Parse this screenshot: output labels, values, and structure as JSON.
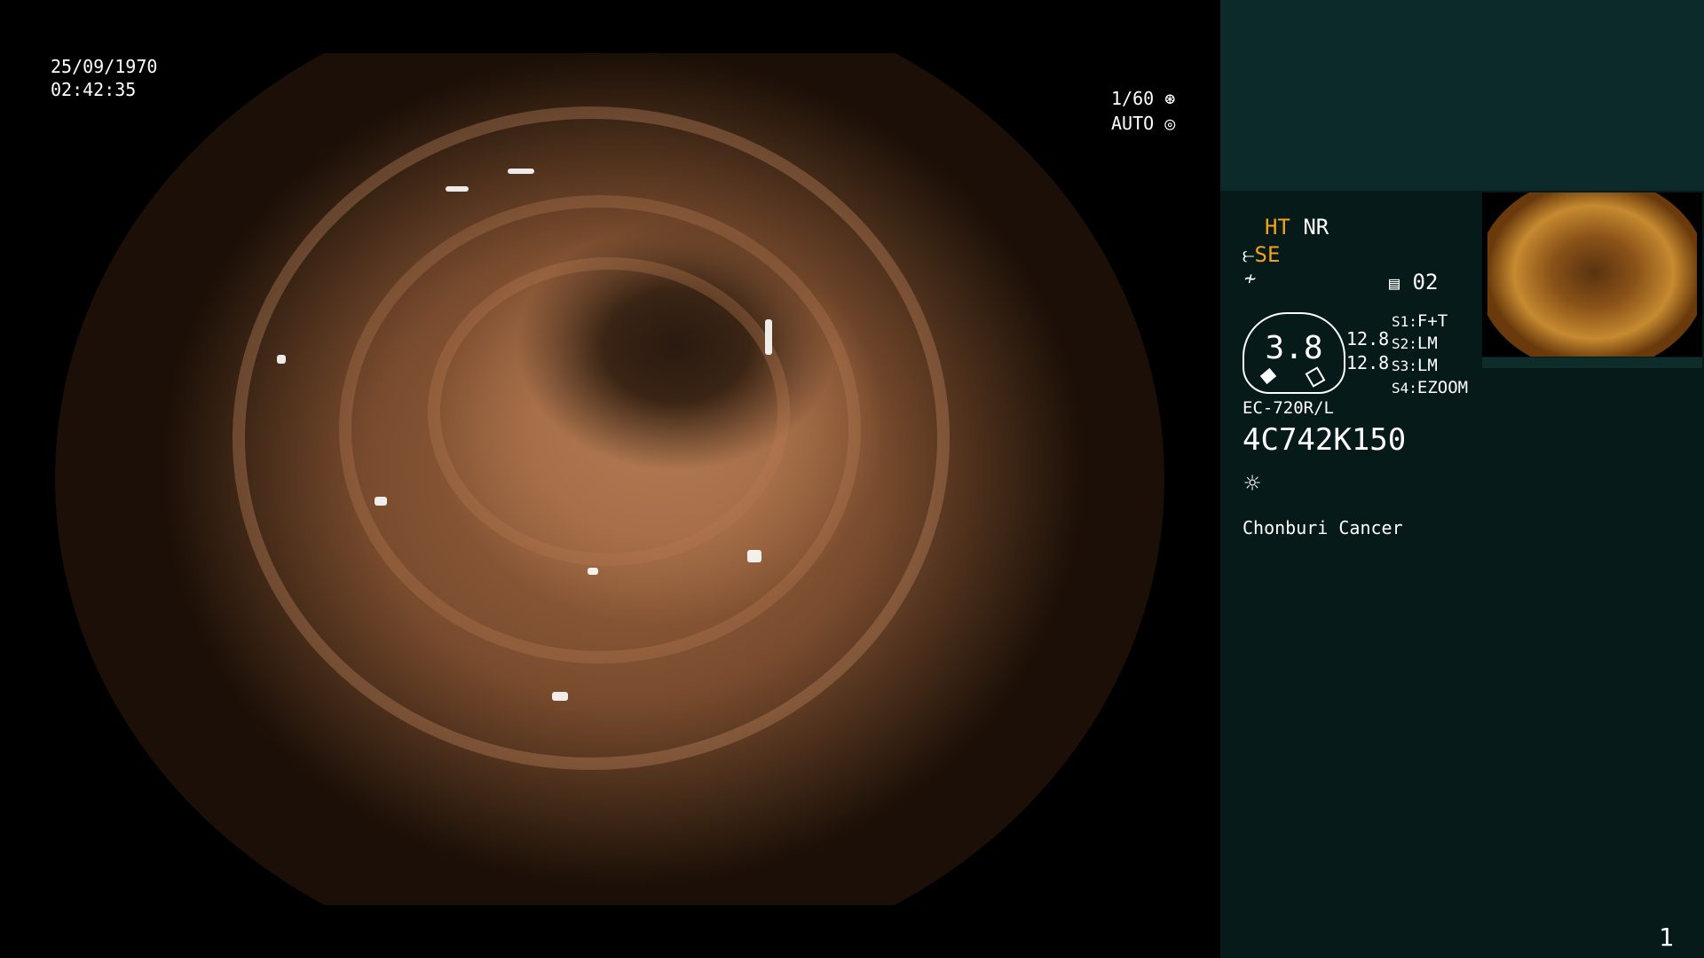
{
  "osd": {
    "date": "25/09/1970",
    "time": "02:42:35",
    "shutter": "1/60",
    "shutter_icon": "aperture-icon",
    "iris": "AUTO",
    "iris_icon": "iris-icon"
  },
  "panel": {
    "ht": "HT",
    "nr": "NR",
    "se": "SE",
    "se_icon": "structure-enhance-icon",
    "mode_icon": "color-mode-icon",
    "storage_icon": "storage-icon",
    "storage_num": "02",
    "zoom_value": "3.8",
    "values": [
      "12.8",
      "12.8"
    ],
    "switches": [
      {
        "key": "S1",
        "value": "F+T"
      },
      {
        "key": "S2",
        "value": "LM"
      },
      {
        "key": "S3",
        "value": "LM"
      },
      {
        "key": "S4",
        "value": "EZOOM"
      }
    ],
    "scope_model": "EC-720R/L",
    "serial": "4C742K150",
    "light_icon": "light-icon",
    "hospital": "Chonburi Cancer",
    "page_number": "1"
  }
}
